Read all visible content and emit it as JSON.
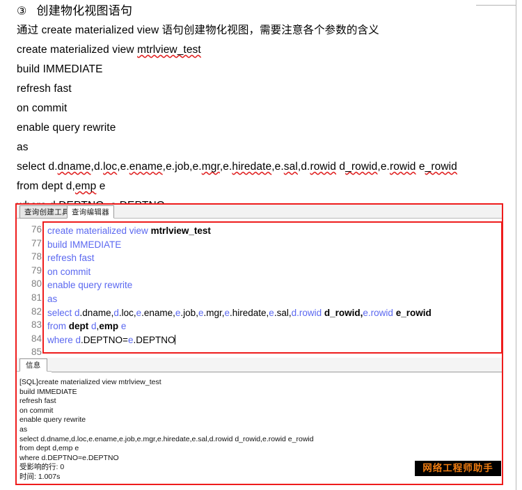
{
  "document": {
    "heading_number": "③",
    "heading_text": "创建物化视图语句",
    "intro": "通过 create materialized view 语句创建物化视图，需要注意各个参数的含义",
    "sql_lines": [
      "create materialized view mtrlview_test",
      "build IMMEDIATE",
      "refresh fast",
      "on commit",
      "enable query rewrite",
      "as",
      "select d.dname,d.loc,e.ename,e.job,e.mgr,e.hiredate,e.sal,d.rowid d_rowid,e.rowid e_rowid",
      "from dept d,emp e",
      "where d.DEPTNO=e.DEPTNO"
    ]
  },
  "tool_window": {
    "tabs": [
      {
        "label": "查询创建工具",
        "active": false
      },
      {
        "label": "查询编辑器",
        "active": true
      }
    ],
    "editor": {
      "line_numbers": [
        "76",
        "77",
        "78",
        "79",
        "80",
        "81",
        "82",
        "83",
        "84",
        "85"
      ],
      "lines": [
        {
          "n": "76",
          "tokens": [
            {
              "t": "create materialized view ",
              "c": "kw"
            },
            {
              "t": "mtrlview_test",
              "c": "id"
            }
          ]
        },
        {
          "n": "77",
          "tokens": [
            {
              "t": "build IMMEDIATE",
              "c": "kw"
            }
          ]
        },
        {
          "n": "78",
          "tokens": [
            {
              "t": "refresh fast",
              "c": "kw"
            }
          ]
        },
        {
          "n": "79",
          "tokens": [
            {
              "t": "on commit",
              "c": "kw"
            }
          ]
        },
        {
          "n": "80",
          "tokens": [
            {
              "t": "enable query rewrite",
              "c": "kw"
            }
          ]
        },
        {
          "n": "81",
          "tokens": [
            {
              "t": "as",
              "c": "kw"
            }
          ]
        },
        {
          "n": "82",
          "tokens": [
            {
              "t": "select ",
              "c": "kw"
            },
            {
              "t": "d",
              "c": "al"
            },
            {
              "t": ".dname,",
              "c": "pl"
            },
            {
              "t": "d",
              "c": "al"
            },
            {
              "t": ".loc,",
              "c": "pl"
            },
            {
              "t": "e",
              "c": "al"
            },
            {
              "t": ".ename,",
              "c": "pl"
            },
            {
              "t": "e",
              "c": "al"
            },
            {
              "t": ".job,",
              "c": "pl"
            },
            {
              "t": "e",
              "c": "al"
            },
            {
              "t": ".mgr,",
              "c": "pl"
            },
            {
              "t": "e",
              "c": "al"
            },
            {
              "t": ".hiredate,",
              "c": "pl"
            },
            {
              "t": "e",
              "c": "al"
            },
            {
              "t": ".sal,",
              "c": "pl"
            },
            {
              "t": "d.rowid",
              "c": "al"
            },
            {
              "t": " ",
              "c": "pl"
            },
            {
              "t": "d_rowid,",
              "c": "id"
            },
            {
              "t": "e.rowid",
              "c": "al"
            },
            {
              "t": " ",
              "c": "pl"
            },
            {
              "t": "e_rowid",
              "c": "id"
            }
          ]
        },
        {
          "n": "83",
          "tokens": [
            {
              "t": "from ",
              "c": "kw"
            },
            {
              "t": "dept",
              "c": "id"
            },
            {
              "t": " ",
              "c": "pl"
            },
            {
              "t": "d",
              "c": "al"
            },
            {
              "t": ",",
              "c": "pl"
            },
            {
              "t": "emp",
              "c": "id"
            },
            {
              "t": " ",
              "c": "pl"
            },
            {
              "t": "e",
              "c": "al"
            }
          ]
        },
        {
          "n": "84",
          "tokens": [
            {
              "t": "where ",
              "c": "kw"
            },
            {
              "t": "d",
              "c": "al"
            },
            {
              "t": ".DEPTNO=",
              "c": "pl"
            },
            {
              "t": "e",
              "c": "al"
            },
            {
              "t": ".DEPTNO",
              "c": "pl"
            }
          ],
          "caret": true
        },
        {
          "n": "85",
          "tokens": []
        }
      ]
    }
  },
  "info_panel": {
    "tab_label": "信息",
    "log_lines": [
      "[SQL]create materialized view mtrlview_test",
      "build IMMEDIATE",
      "refresh fast",
      "on commit",
      "enable query rewrite",
      "as",
      "select d.dname,d.loc,e.ename,e.job,e.mgr,e.hiredate,e.sal,d.rowid d_rowid,e.rowid e_rowid",
      "from dept d,emp e",
      "where d.DEPTNO=e.DEPTNO",
      "受影响的行: 0",
      "时间: 1.007s"
    ]
  },
  "watermark": {
    "text": "网络工程师助手",
    "background": "#000000",
    "color": "#f07c10"
  },
  "colors": {
    "annotation_red": "#ee1c1c",
    "keyword_blue": "#5b68f0",
    "gutter_grey": "#808080",
    "spellcheck_red": "#e02020"
  }
}
